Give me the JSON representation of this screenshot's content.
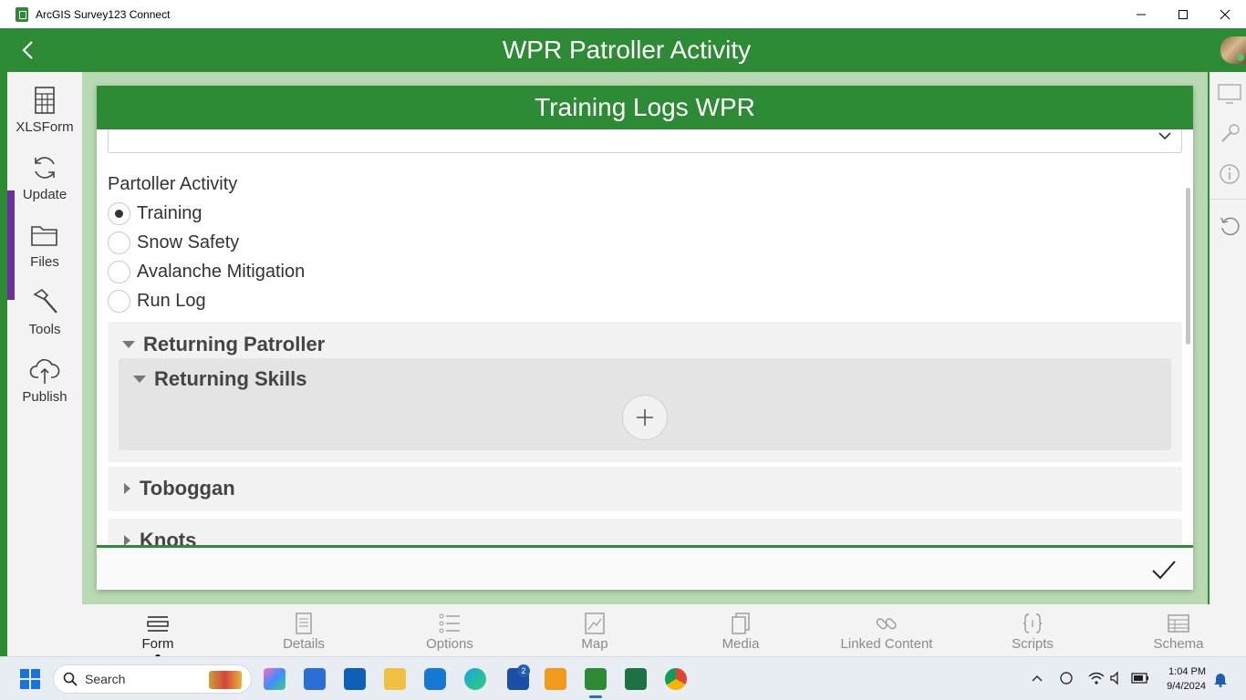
{
  "window": {
    "title": "ArcGIS Survey123 Connect"
  },
  "appbar": {
    "title": "WPR Patroller Activity"
  },
  "sidebar": {
    "items": [
      {
        "label": "XLSForm",
        "icon": "spreadsheet-icon"
      },
      {
        "label": "Update",
        "icon": "refresh-icon"
      },
      {
        "label": "Files",
        "icon": "folder-icon"
      },
      {
        "label": "Tools",
        "icon": "hammer-icon"
      },
      {
        "label": "Publish",
        "icon": "cloud-upload-icon"
      }
    ]
  },
  "form": {
    "header": "Training Logs WPR",
    "question_label": "Partoller Activity",
    "options": [
      {
        "label": "Training",
        "selected": true
      },
      {
        "label": "Snow Safety",
        "selected": false
      },
      {
        "label": "Avalanche Mitigation",
        "selected": false
      },
      {
        "label": "Run Log",
        "selected": false
      }
    ],
    "groups": {
      "returning_patroller": "Returning Patroller",
      "returning_skills": "Returning Skills",
      "toboggan": "Toboggan",
      "knots": "Knots"
    }
  },
  "tabs": [
    {
      "label": "Form",
      "icon": "form-icon",
      "active": true
    },
    {
      "label": "Details",
      "icon": "document-icon",
      "active": false
    },
    {
      "label": "Options",
      "icon": "list-icon",
      "active": false
    },
    {
      "label": "Map",
      "icon": "map-icon",
      "active": false
    },
    {
      "label": "Media",
      "icon": "media-icon",
      "active": false
    },
    {
      "label": "Linked Content",
      "icon": "link-icon",
      "active": false
    },
    {
      "label": "Scripts",
      "icon": "braces-icon",
      "active": false
    },
    {
      "label": "Schema",
      "icon": "table-icon",
      "active": false
    }
  ],
  "taskbar": {
    "search_label": "Search",
    "time": "1:04 PM",
    "date": "9/4/2024",
    "badge_count": "2"
  },
  "colors": {
    "brand_green": "#2e8b35",
    "preview_bg": "#b9d9b4"
  }
}
